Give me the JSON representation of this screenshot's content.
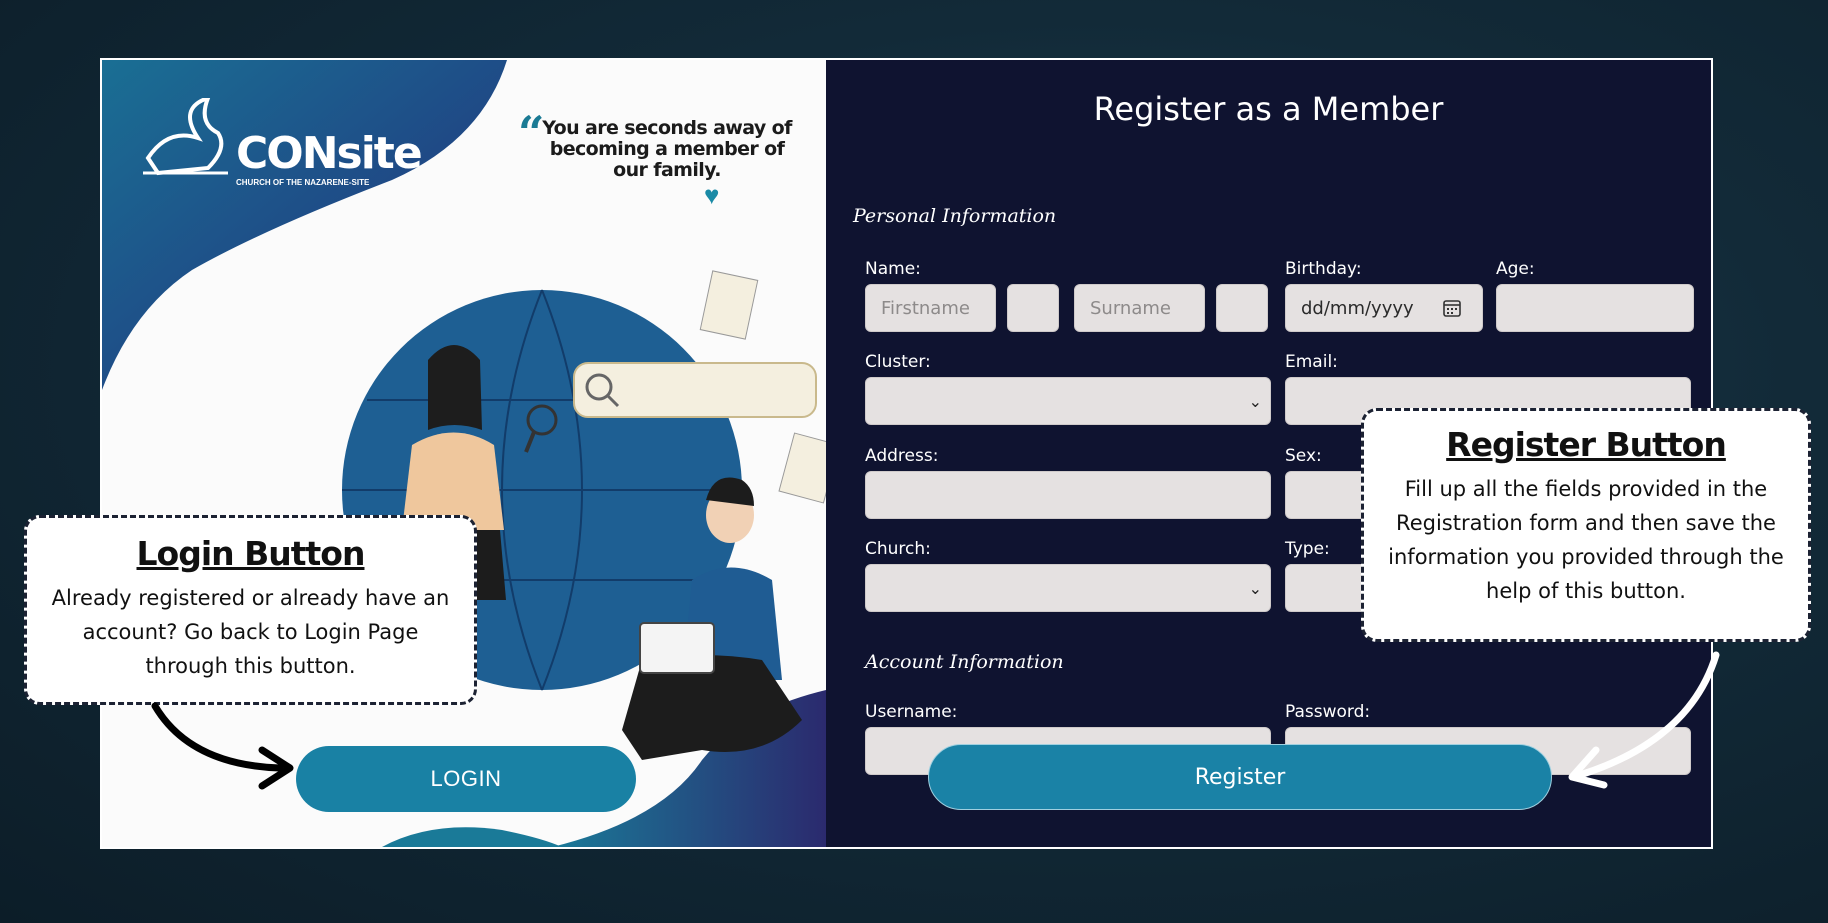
{
  "left": {
    "logo_text": "CONsite",
    "logo_subtitle": "CHURCH OF THE NAZARENE-SITE",
    "quote": "You are seconds away of becoming a member of our family.",
    "login_label": "LOGIN"
  },
  "form": {
    "title": "Register as a Member",
    "personal_section": "Personal Information",
    "account_section": "Account Information",
    "labels": {
      "name": "Name:",
      "birthday": "Birthday:",
      "age": "Age:",
      "cluster": "Cluster:",
      "email": "Email:",
      "address": "Address:",
      "sex": "Sex:",
      "church": "Church:",
      "type": "Type:",
      "username": "Username:",
      "password": "Password:"
    },
    "placeholders": {
      "firstname": "Firstname",
      "surname": "Surname",
      "birthday": "dd/mm/yyyy"
    },
    "register_label": "Register"
  },
  "callouts": {
    "login": {
      "title": "Login Button",
      "body": "Already registered or already have an account? Go back to Login Page through this button."
    },
    "register": {
      "title": "Register Button",
      "body": "Fill up all the fields provided in the Registration form and then save the information you provided through the help of this button."
    }
  },
  "colors": {
    "background": "#122a38",
    "form_panel": "#0f1330",
    "accent": "#1a82a6",
    "field": "#e5e1e1",
    "blob_dark": "#2b2a6e"
  }
}
